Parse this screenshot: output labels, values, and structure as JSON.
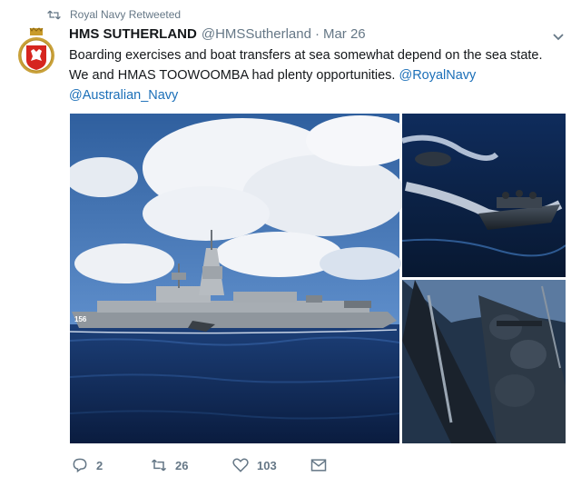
{
  "retweet_context": {
    "label": "Royal Navy Retweeted"
  },
  "author": {
    "display_name": "HMS SUTHERLAND",
    "handle": "@HMSSutherland",
    "separator": "·",
    "date": "Mar 26"
  },
  "tweet": {
    "text_line1": "Boarding exercises and boat transfers at sea somewhat depend on the sea state.",
    "text_line2_prefix": "We and HMAS TOOWOOMBA had plenty opportunities.",
    "mention1": "@RoyalNavy",
    "mention2": "@Australian_Navy"
  },
  "actions": {
    "replies": "2",
    "retweets": "26",
    "likes": "103"
  },
  "icons": {
    "retweet": "retweet-icon",
    "reply": "reply-icon",
    "like": "heart-icon",
    "dm": "envelope-icon",
    "caret": "chevron-down-icon"
  },
  "media": {
    "ship_hull_number": "156"
  }
}
